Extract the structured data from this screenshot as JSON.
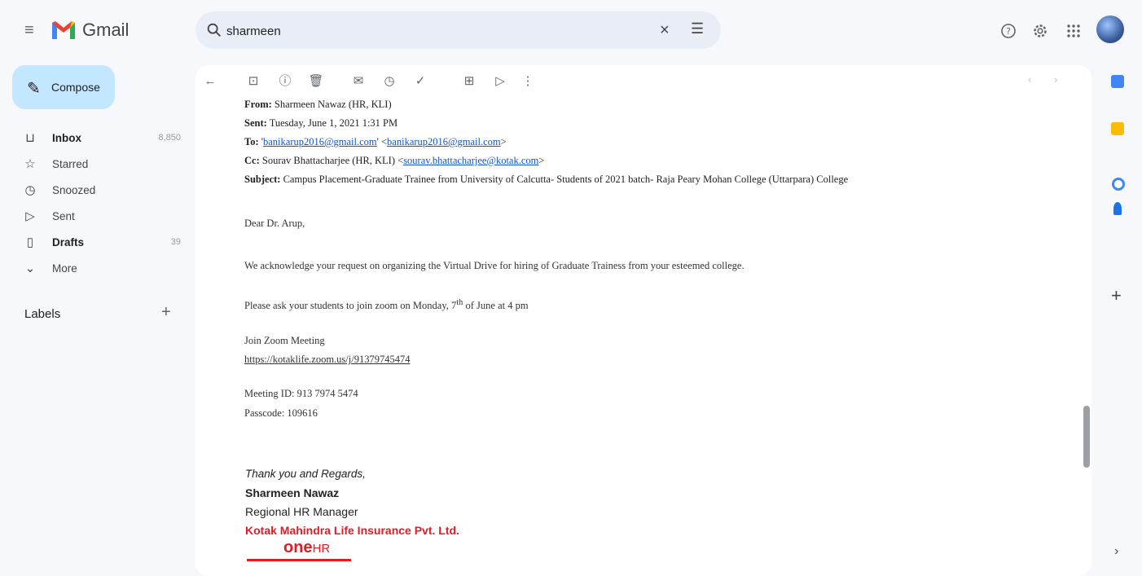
{
  "app": {
    "name": "Gmail"
  },
  "search": {
    "value": "sharmeen",
    "clear_glyph": "×",
    "tune_glyph": "☰"
  },
  "sidebar": {
    "compose_label": "Compose",
    "items": [
      {
        "label": "Inbox",
        "count": "8,850",
        "icon": "inbox-icon",
        "bold": true
      },
      {
        "label": "Starred",
        "count": "",
        "icon": "star-icon",
        "bold": false
      },
      {
        "label": "Snoozed",
        "count": "",
        "icon": "clock-icon",
        "bold": false
      },
      {
        "label": "Sent",
        "count": "",
        "icon": "send-icon",
        "bold": false
      },
      {
        "label": "Drafts",
        "count": "39",
        "icon": "draft-icon",
        "bold": true
      },
      {
        "label": "More",
        "count": "",
        "icon": "chevron-down-icon",
        "bold": false
      }
    ],
    "labels_heading": "Labels",
    "labels_add": "+"
  },
  "email": {
    "from_label": "From:",
    "from_value": "Sharmeen Nawaz (HR, KLI)",
    "sent_label": "Sent:",
    "sent_value": "Tuesday, June 1, 2021 1:31 PM",
    "to_label": "To:",
    "to_q1": "'",
    "to_link1": "banikarup2016@gmail.com",
    "to_q2": "' <",
    "to_link2": "banikarup2016@gmail.com",
    "to_q3": ">",
    "cc_label": "Cc:",
    "cc_name": "Sourav Bhattacharjee (HR, KLI) <",
    "cc_link": "sourav.bhattacharjee@kotak.com",
    "cc_end": ">",
    "subject_label": "Subject:",
    "subject_value": "Campus Placement-Graduate Trainee from University of Calcutta- Students of 2021 batch- Raja Peary Mohan College (Uttarpara) College",
    "greeting": "Dear Dr. Arup,",
    "para1": "We acknowledge your request on organizing the Virtual Drive for hiring of Graduate Trainess from your esteemed college.",
    "para2_pre": "Please ask your students to join zoom on Monday, 7",
    "para2_sup": "th",
    "para2_post": " of June at 4 pm",
    "zoom_heading": "Join Zoom Meeting",
    "zoom_link": "https://kotaklife.zoom.us/j/91379745474",
    "meeting_id": "Meeting ID: 913 7974 5474",
    "passcode": "Passcode: 109616",
    "sig_thanks": "Thank you and Regards,",
    "sig_name": "Sharmeen Nawaz",
    "sig_role": "Regional HR Manager",
    "sig_company": "Kotak Mahindra Life Insurance Pvt. Ltd.",
    "logo_one": "one",
    "logo_hr": "HR"
  },
  "colors": {
    "compose_bg": "#c2e7ff",
    "search_bg": "#e9eef6",
    "link": "#1155cc",
    "brand_red": "#e31b23",
    "app_bg": "#f6f8fc"
  }
}
